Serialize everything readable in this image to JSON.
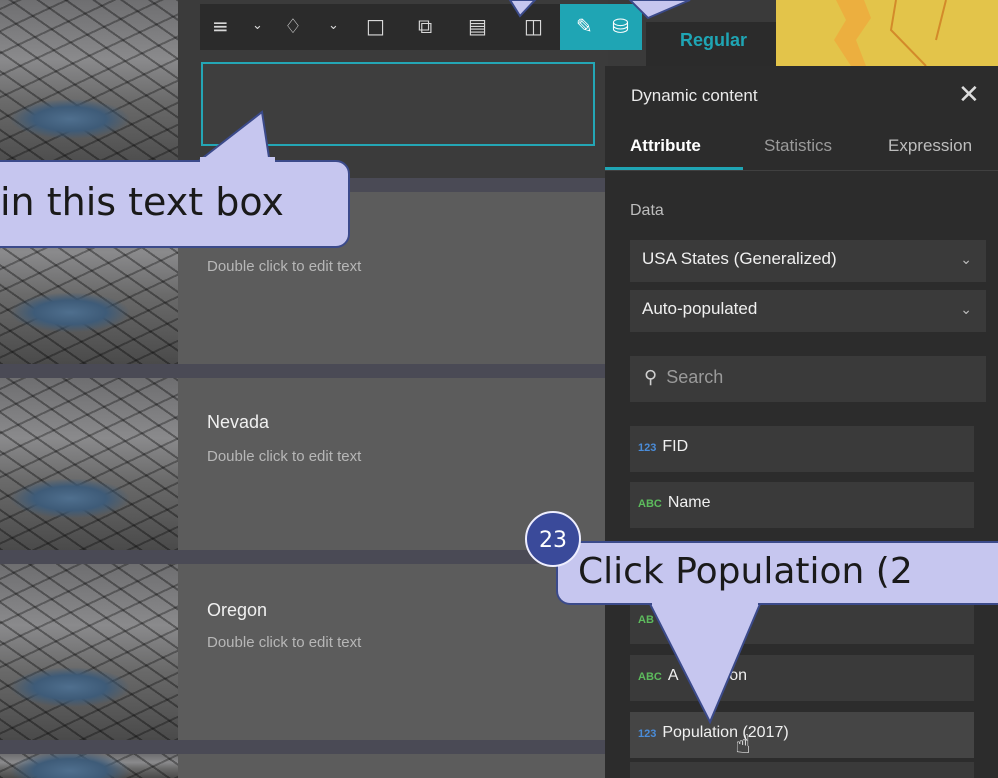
{
  "toolbar": {
    "icons": [
      "align-icon",
      "chevron-down-icon",
      "layers-icon",
      "chevron-down-icon",
      "unlock-icon",
      "duplicate-icon",
      "edit-list-icon",
      "trash-icon",
      "pencil-icon",
      "database-icon"
    ],
    "style_label": "Regular"
  },
  "list": {
    "items": [
      {
        "title": "",
        "subtitle": "Double click to edit text"
      },
      {
        "title": "Nevada",
        "subtitle": "Double click to edit text"
      },
      {
        "title": "Oregon",
        "subtitle": "Double click to edit text"
      }
    ]
  },
  "panel": {
    "title": "Dynamic content",
    "tabs": [
      "Attribute",
      "Statistics",
      "Expression"
    ],
    "active_tab": "Attribute",
    "data_label": "Data",
    "layer_select": "USA States (Generalized)",
    "mode_select": "Auto-populated",
    "search_placeholder": "Search",
    "fields": [
      {
        "type": "123",
        "name": "FID"
      },
      {
        "type": "ABC",
        "name": "Name"
      },
      {
        "type": "AB",
        "name": ""
      },
      {
        "type": "ABC",
        "name": "A       lation"
      },
      {
        "type": "123",
        "name": "Population (2017)"
      }
    ]
  },
  "annotations": {
    "textbox_hint": "in this text box",
    "step_number": "23",
    "step_text": "Click Population (2"
  },
  "colors": {
    "accent": "#1fa5b4",
    "callout_fill": "#c6c6ef",
    "callout_border": "#3b4a8a",
    "badge": "#3a4a9a"
  }
}
